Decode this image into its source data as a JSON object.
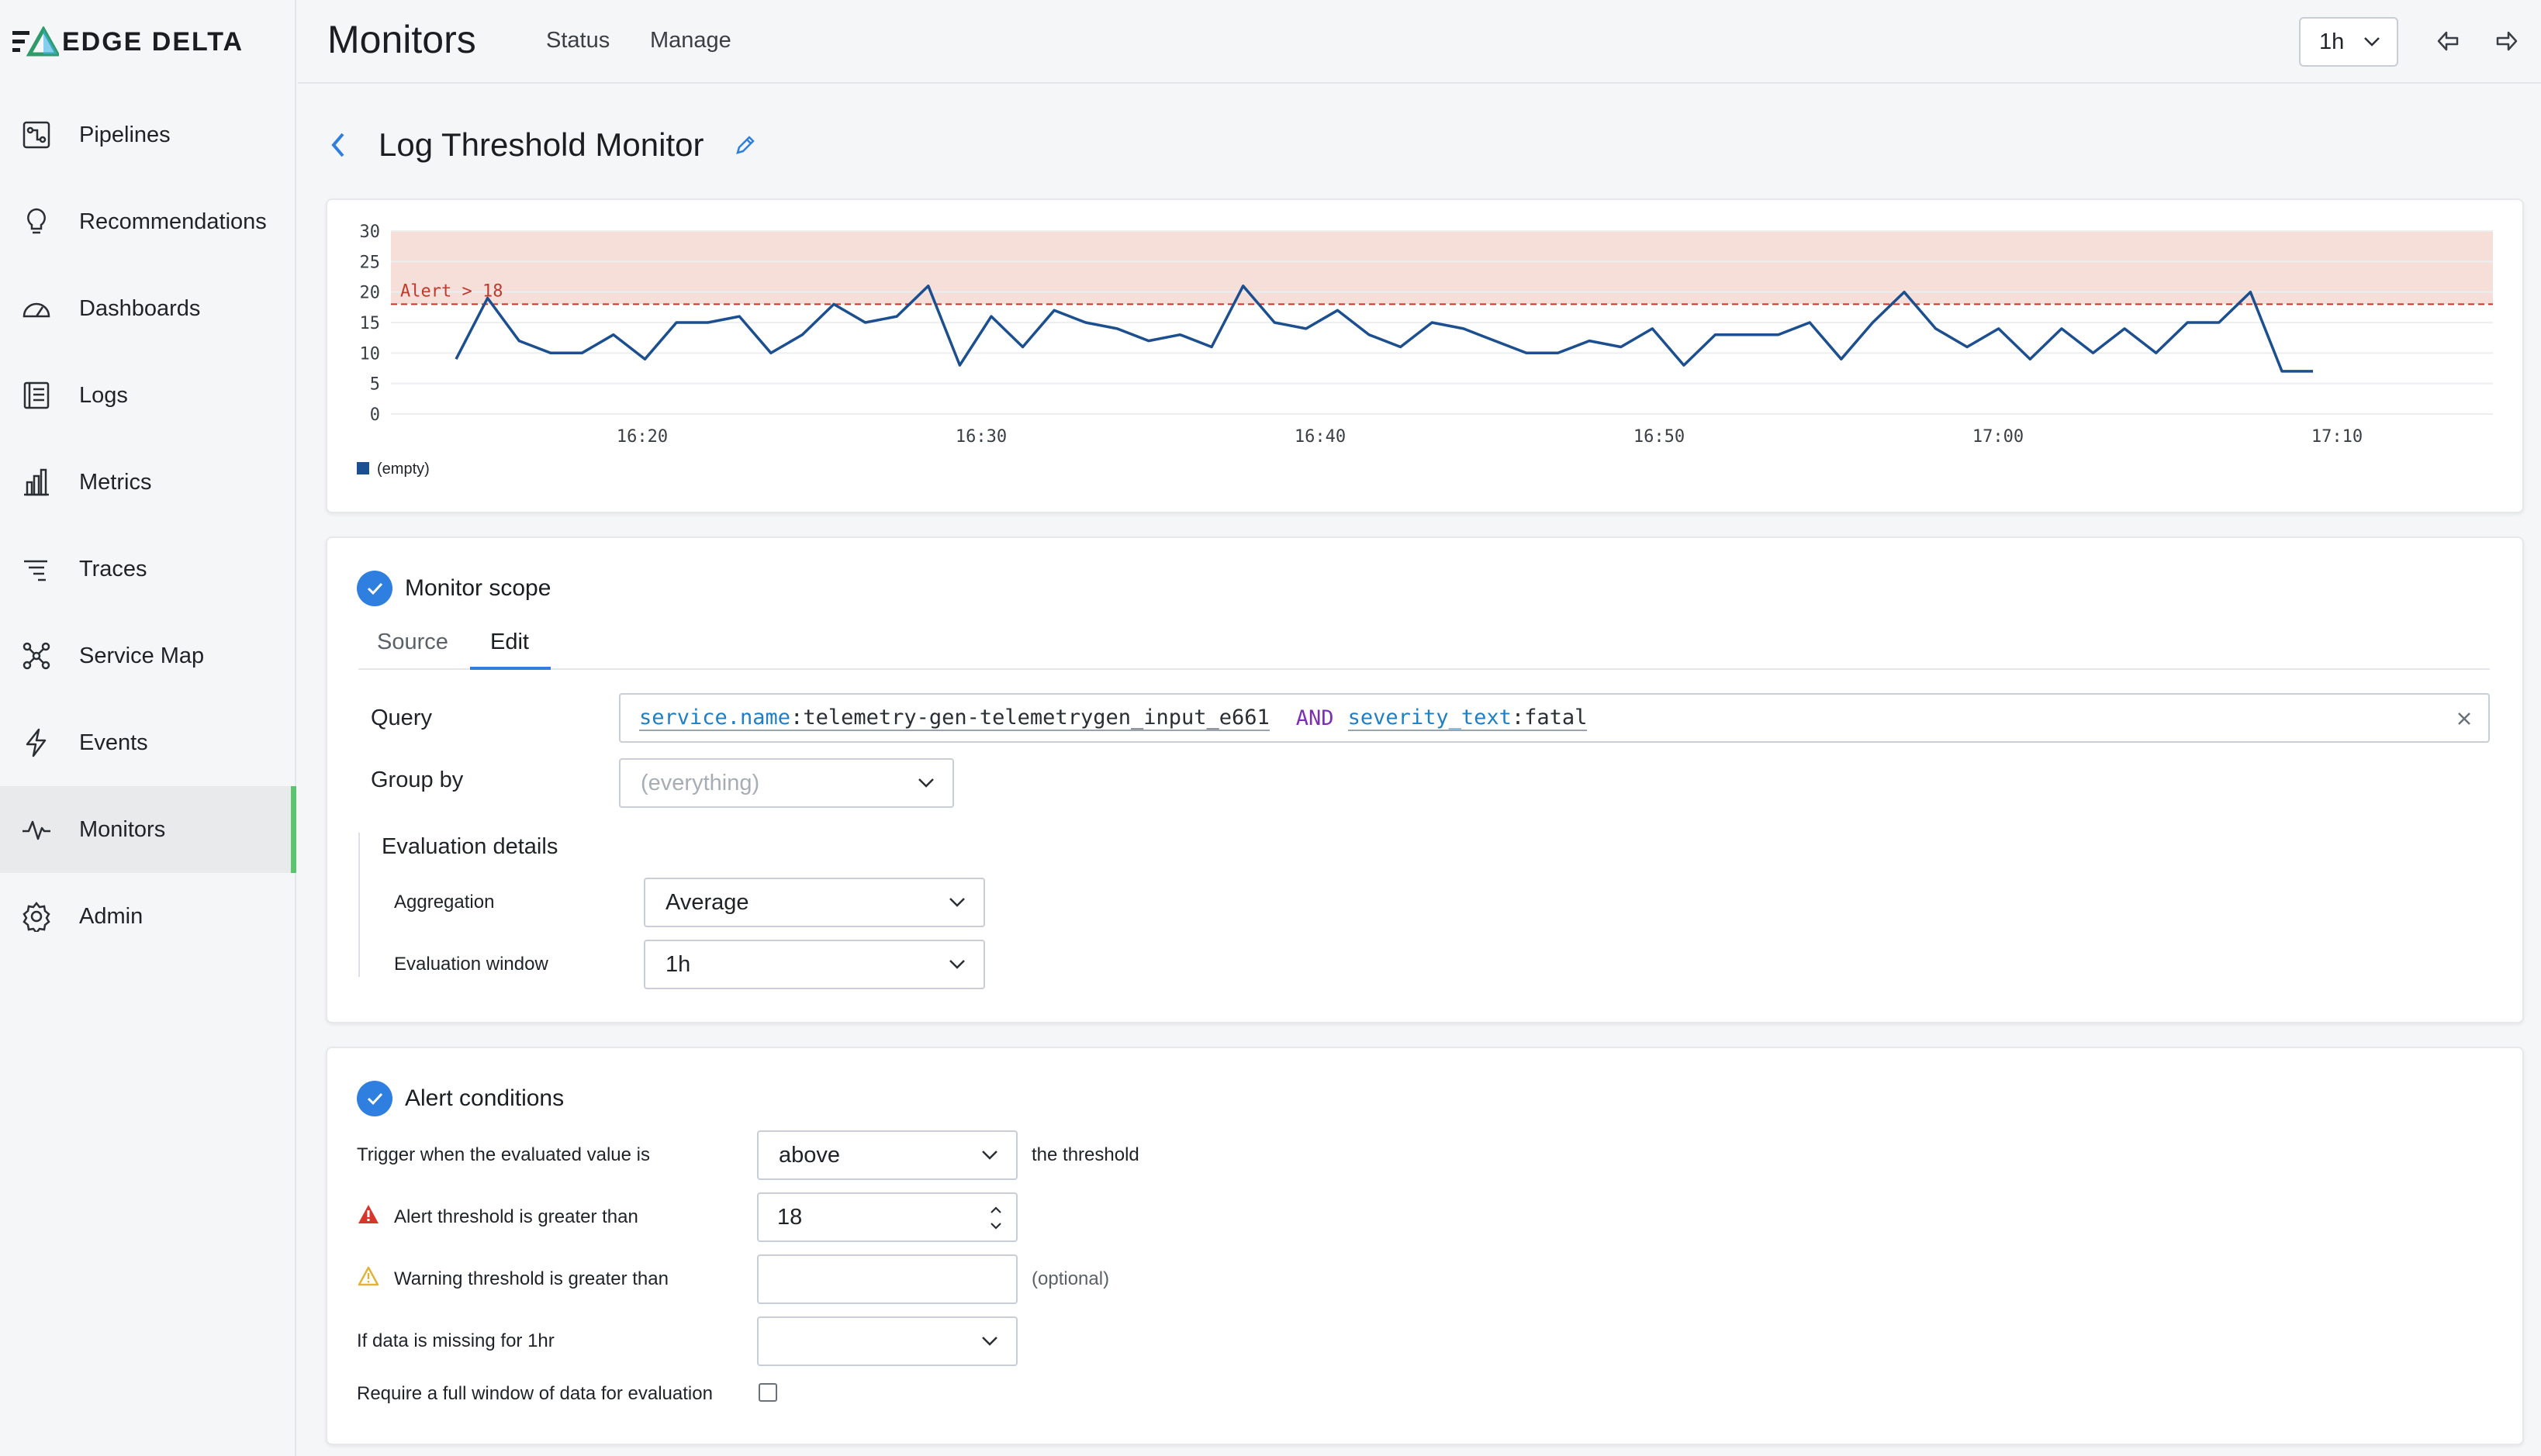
{
  "brand": {
    "logo_text": "EDGE DELTA"
  },
  "sidebar": {
    "items": [
      {
        "label": "Pipelines",
        "icon": "pipelines-icon"
      },
      {
        "label": "Recommendations",
        "icon": "lightbulb-icon"
      },
      {
        "label": "Dashboards",
        "icon": "gauge-icon"
      },
      {
        "label": "Logs",
        "icon": "logs-icon"
      },
      {
        "label": "Metrics",
        "icon": "bar-chart-icon"
      },
      {
        "label": "Traces",
        "icon": "traces-icon"
      },
      {
        "label": "Service Map",
        "icon": "service-map-icon"
      },
      {
        "label": "Events",
        "icon": "lightning-icon"
      },
      {
        "label": "Monitors",
        "icon": "pulse-icon",
        "active": true
      },
      {
        "label": "Admin",
        "icon": "gear-icon"
      }
    ]
  },
  "header": {
    "title": "Monitors",
    "tabs": [
      "Status",
      "Manage"
    ],
    "time_range": "1h"
  },
  "page": {
    "title": "Log Threshold Monitor"
  },
  "chart_data": {
    "type": "line",
    "x_tick_labels": [
      "16:20",
      "16:30",
      "16:40",
      "16:50",
      "17:00",
      "17:10"
    ],
    "y_ticks": [
      0,
      5,
      10,
      15,
      20,
      25,
      30
    ],
    "ylim": [
      0,
      30
    ],
    "threshold": {
      "value": 18,
      "label": "Alert > 18"
    },
    "series": [
      {
        "name": "(empty)",
        "color": "#1c4f8f",
        "values": [
          9,
          19,
          12,
          10,
          10,
          13,
          9,
          15,
          15,
          16,
          10,
          13,
          18,
          15,
          16,
          21,
          8,
          16,
          11,
          17,
          15,
          14,
          12,
          13,
          11,
          21,
          15,
          14,
          17,
          13,
          11,
          15,
          14,
          12,
          10,
          10,
          12,
          11,
          14,
          8,
          13,
          13,
          13,
          15,
          9,
          15,
          20,
          14,
          11,
          14,
          9,
          14,
          10,
          14,
          10,
          15,
          15,
          20,
          7,
          7
        ]
      }
    ],
    "legend": [
      "(empty)"
    ]
  },
  "scope": {
    "title": "Monitor scope",
    "tabs": [
      "Source",
      "Edit"
    ],
    "active_tab": "Edit",
    "query_label": "Query",
    "query": {
      "key1": "service.name",
      "val1": ":telemetry-gen-telemetrygen_input_e661",
      "op": "AND",
      "key2": "severity_text",
      "val2": ":fatal"
    },
    "group_by_label": "Group by",
    "group_by_placeholder": "(everything)",
    "eval_title": "Evaluation details",
    "aggregation_label": "Aggregation",
    "aggregation_value": "Average",
    "window_label": "Evaluation window",
    "window_value": "1h"
  },
  "alert": {
    "title": "Alert conditions",
    "trigger_label": "Trigger when the evaluated value is",
    "trigger_value": "above",
    "trigger_suffix": "the threshold",
    "alert_threshold_label": "Alert threshold is greater than",
    "alert_threshold_value": "18",
    "warning_threshold_label": "Warning threshold is greater than",
    "warning_threshold_value": "",
    "warning_optional": "(optional)",
    "missing_label": "If data is missing for 1hr",
    "missing_value": "",
    "full_window_label": "Require a full window of data for evaluation"
  },
  "colors": {
    "accent": "#2f7fe0",
    "active_nav": "#5cc46e",
    "alert_band": "#f6ded9",
    "threshold": "#c0392b"
  }
}
